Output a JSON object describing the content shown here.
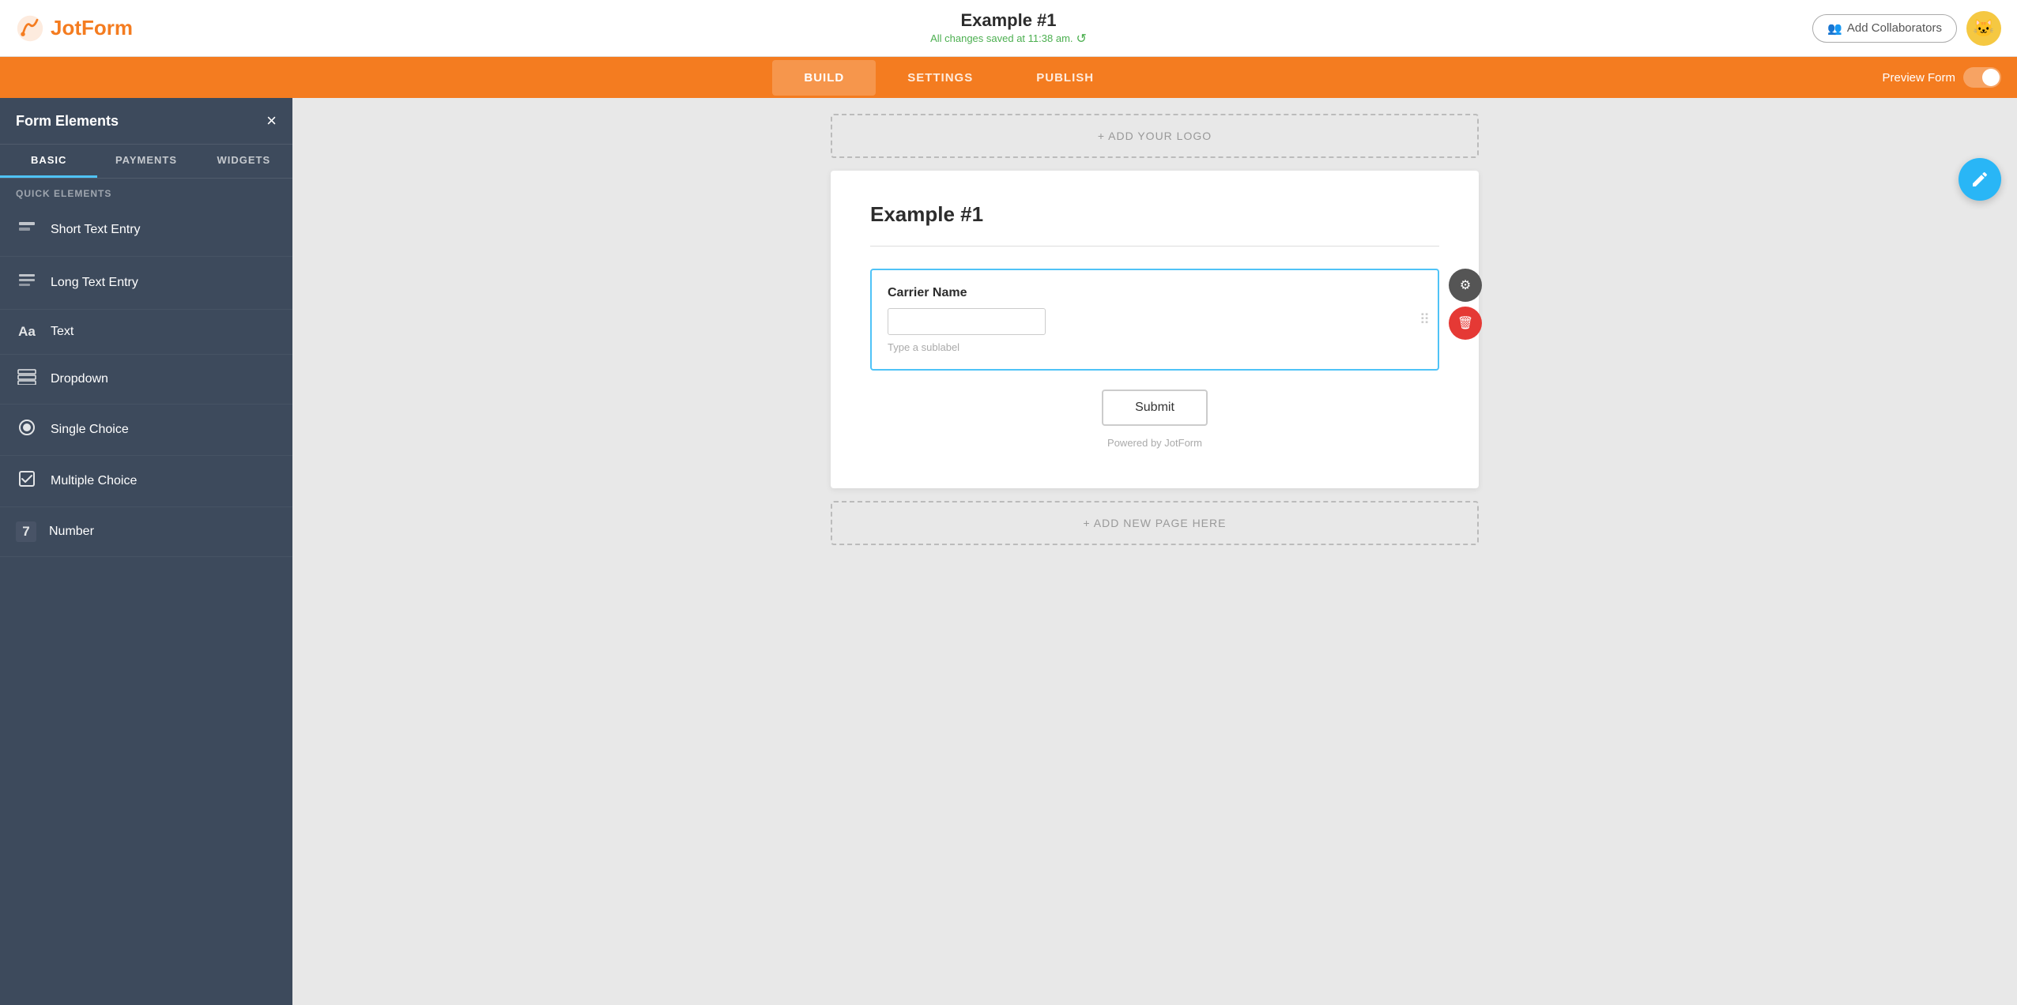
{
  "header": {
    "logo_text": "JotForm",
    "form_title": "Example #1",
    "saved_status": "All changes saved at 11:38 am.",
    "add_collab_label": "Add Collaborators",
    "avatar_emoji": "🐱"
  },
  "nav": {
    "tabs": [
      {
        "id": "build",
        "label": "BUILD",
        "active": true
      },
      {
        "id": "settings",
        "label": "SETTINGS",
        "active": false
      },
      {
        "id": "publish",
        "label": "PUBLISH",
        "active": false
      }
    ],
    "preview_label": "Preview Form"
  },
  "sidebar": {
    "title": "Form Elements",
    "close_label": "×",
    "tabs": [
      {
        "id": "basic",
        "label": "BASIC",
        "active": true
      },
      {
        "id": "payments",
        "label": "PAYMENTS",
        "active": false
      },
      {
        "id": "widgets",
        "label": "WIDGETS",
        "active": false
      }
    ],
    "quick_elements_label": "QUICK ELEMENTS",
    "items": [
      {
        "id": "short-text",
        "icon": "▣",
        "label": "Short Text Entry"
      },
      {
        "id": "long-text",
        "icon": "▤",
        "label": "Long Text Entry"
      },
      {
        "id": "text",
        "icon": "Aa",
        "label": "Text"
      },
      {
        "id": "dropdown",
        "icon": "☰",
        "label": "Dropdown"
      },
      {
        "id": "single-choice",
        "icon": "◉",
        "label": "Single Choice"
      },
      {
        "id": "multiple-choice",
        "icon": "☑",
        "label": "Multiple Choice"
      },
      {
        "id": "number",
        "icon": "7",
        "label": "Number"
      }
    ]
  },
  "canvas": {
    "add_logo_label": "+ ADD YOUR LOGO",
    "form_card": {
      "title": "Example #1",
      "field": {
        "label": "Carrier Name",
        "sublabel": "Type a sublabel"
      },
      "submit_label": "Submit",
      "powered_by": "Powered by JotForm"
    },
    "add_page_label": "+ ADD NEW PAGE HERE"
  }
}
